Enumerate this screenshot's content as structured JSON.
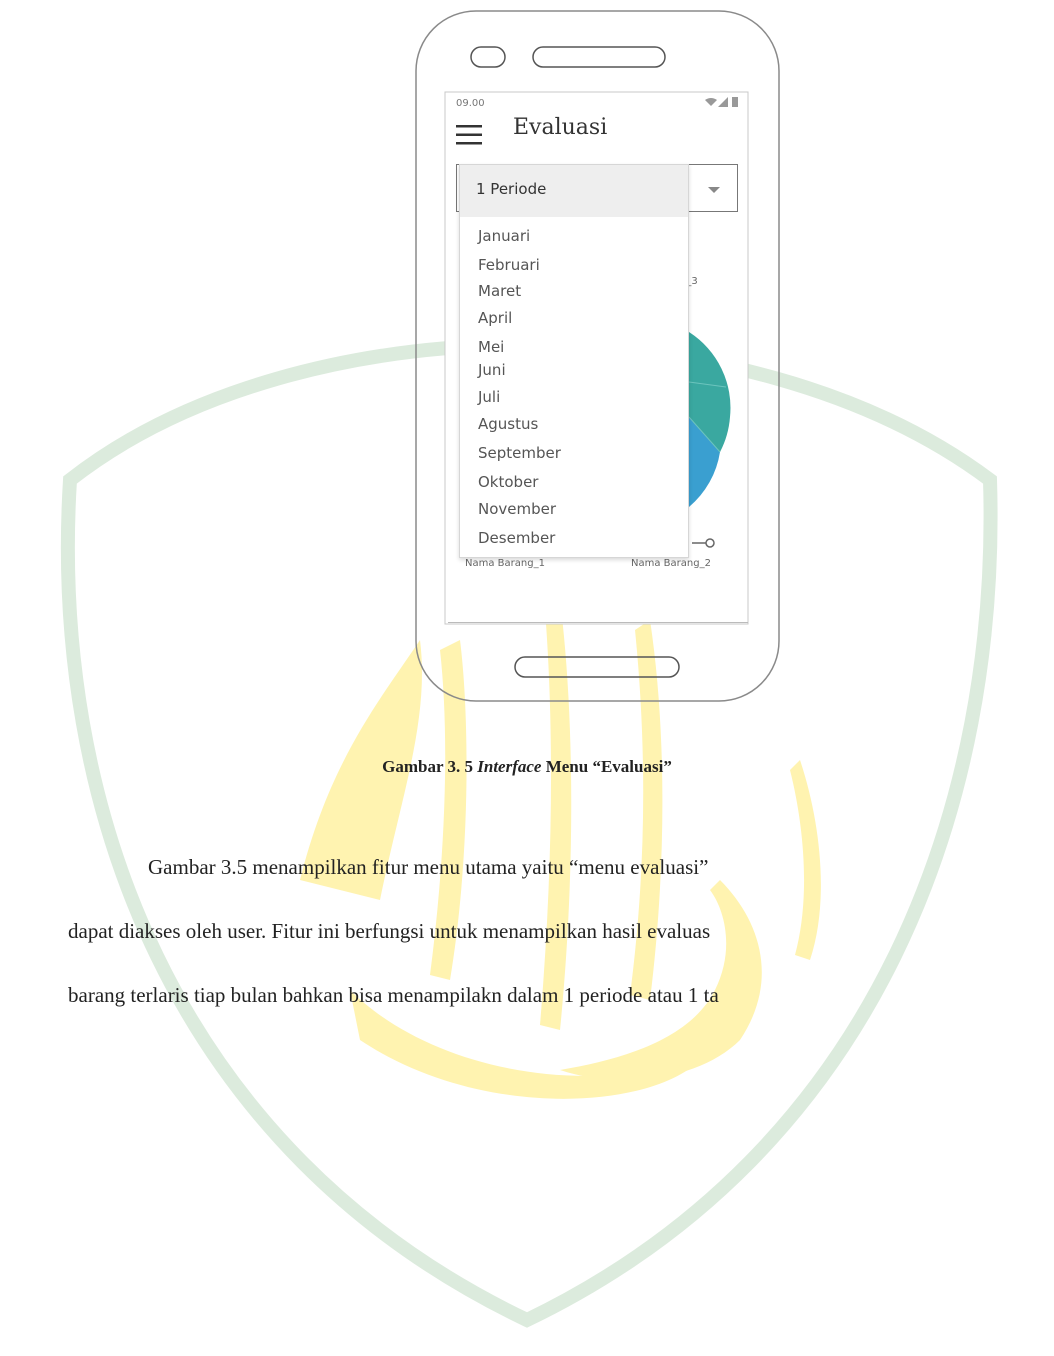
{
  "phone": {
    "status_time": "09.00",
    "app_title": "Evaluasi",
    "period_selected": "1 Periode",
    "months": [
      "Januari",
      "Februari",
      "Maret",
      "April",
      "Mei",
      "Juni",
      "Juli",
      "Agustus",
      "September",
      "Oktober",
      "November",
      "Desember"
    ],
    "chart_labels": {
      "item_1": "Nama Barang_1",
      "item_2": "Nama Barang_2",
      "item_3_partial": "g_3"
    }
  },
  "caption": {
    "prefix": "Gambar 3. 5 ",
    "italic": "Interface",
    "suffix": " Menu “Evaluasi”"
  },
  "paragraph": {
    "line1": "Gambar 3.5 menampilkan fitur menu utama yaitu “menu evaluasi”",
    "line2": "dapat diakses oleh user. Fitur ini berfungsi untuk menampilkan hasil evaluas",
    "line3": "barang terlaris tiap bulan bahkan bisa menampilakn dalam 1 periode atau 1 ta"
  },
  "colors": {
    "watermark_green": "#dcebdd",
    "watermark_yellow": "#fff3b0",
    "chart_teal": "#3aa8a0",
    "chart_blue": "#3a9fd0"
  }
}
